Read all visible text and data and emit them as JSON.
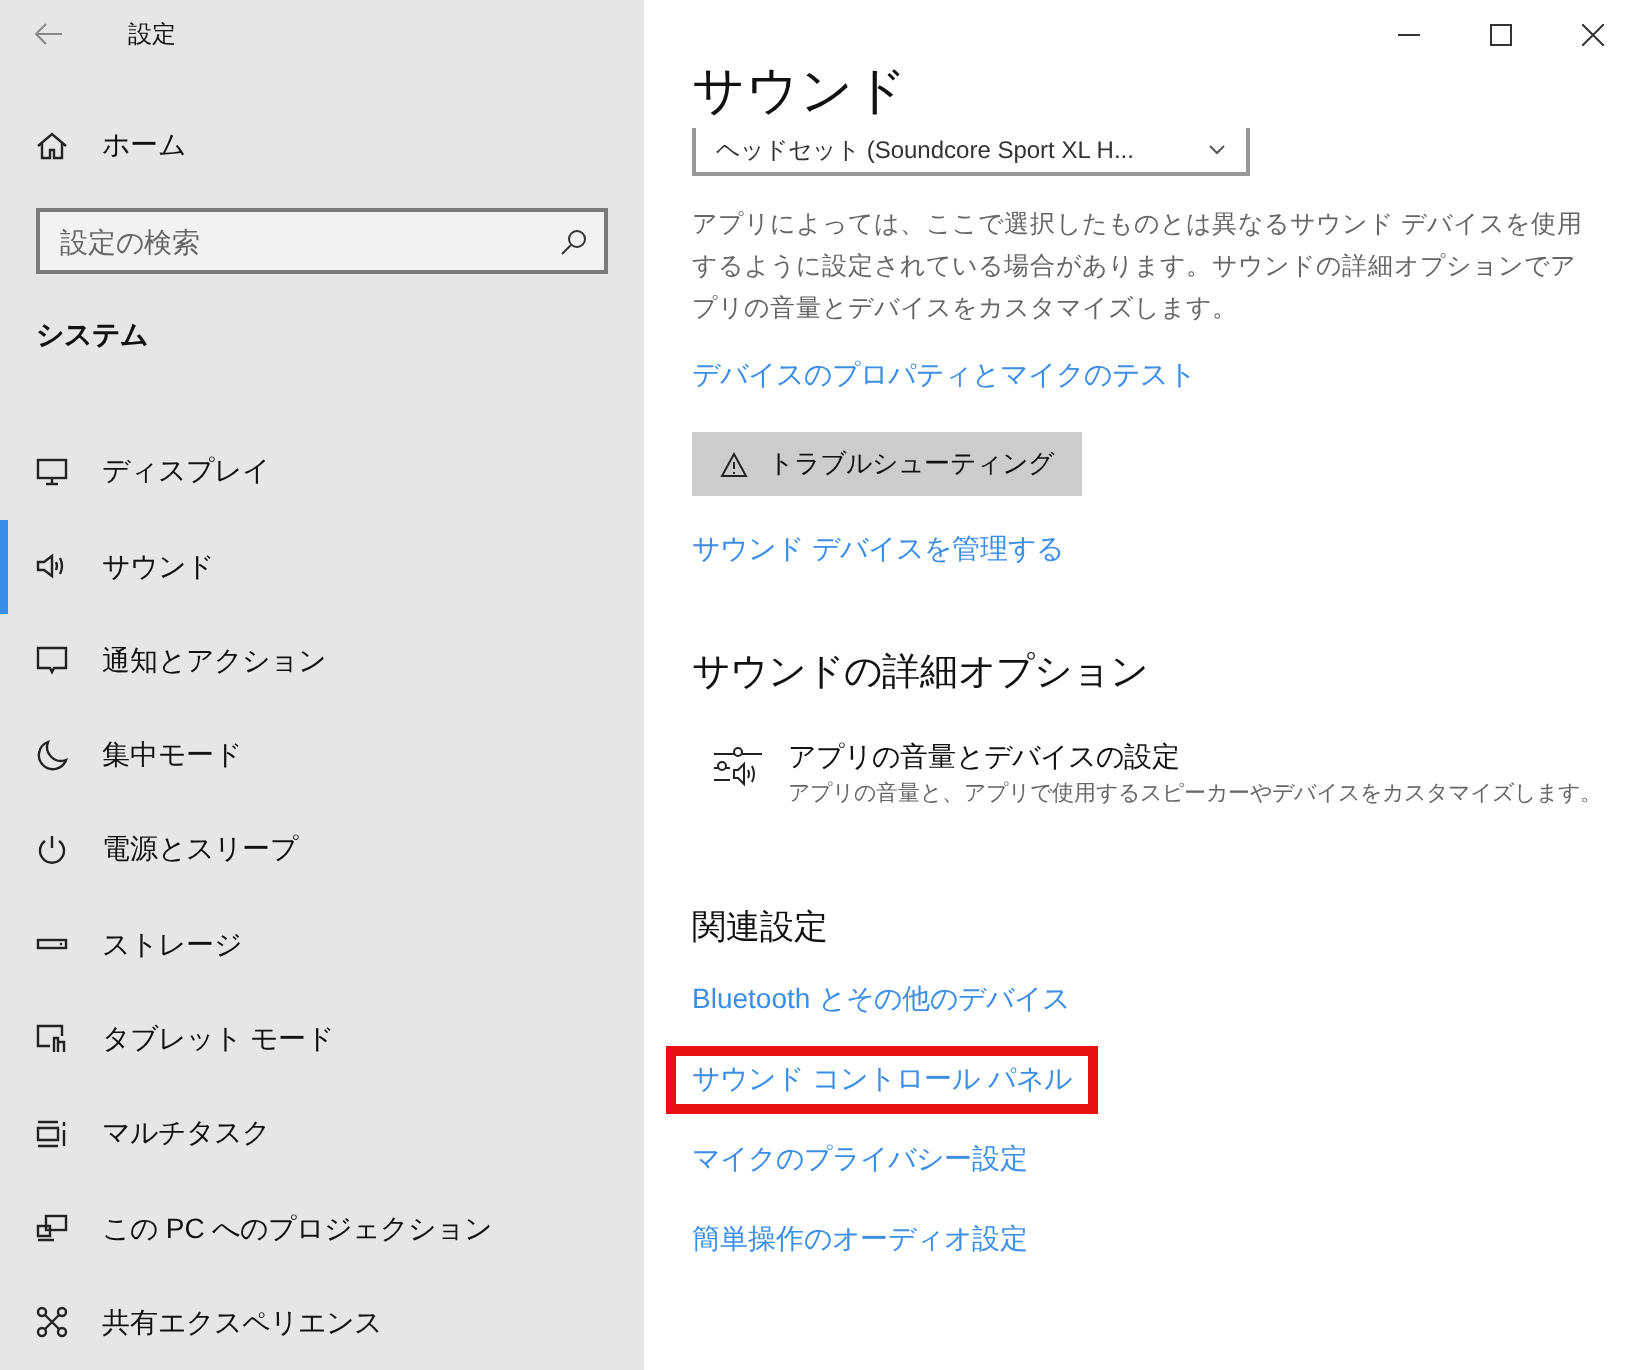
{
  "window": {
    "title": "設定"
  },
  "sidebar": {
    "home": "ホーム",
    "search": {
      "placeholder": "設定の検索"
    },
    "section": "システム",
    "items": [
      {
        "label": "ディスプレイ",
        "selected": false
      },
      {
        "label": "サウンド",
        "selected": true
      },
      {
        "label": "通知とアクション",
        "selected": false
      },
      {
        "label": "集中モード",
        "selected": false
      },
      {
        "label": "電源とスリープ",
        "selected": false
      },
      {
        "label": "ストレージ",
        "selected": false
      },
      {
        "label": "タブレット モード",
        "selected": false
      },
      {
        "label": "マルチタスク",
        "selected": false
      },
      {
        "label": "この PC へのプロジェクション",
        "selected": false
      },
      {
        "label": "共有エクスペリエンス",
        "selected": false
      }
    ]
  },
  "content": {
    "title": "サウンド",
    "device_select": "ヘッドセット (Soundcore Sport XL H...",
    "description": "アプリによっては、ここで選択したものとは異なるサウンド デバイスを使用するように設定されている場合があります。サウンドの詳細オプションでアプリの音量とデバイスをカスタマイズします。",
    "properties_link": "デバイスのプロパティとマイクのテスト",
    "troubleshoot_button": "トラブルシューティング",
    "manage_link": "サウンド デバイスを管理する",
    "advanced": {
      "heading": "サウンドの詳細オプション",
      "title": "アプリの音量とデバイスの設定",
      "subtitle": "アプリの音量と、アプリで使用するスピーカーやデバイスをカスタマイズします。"
    },
    "related": {
      "heading": "関連設定",
      "links": [
        {
          "label": "Bluetooth とその他のデバイス",
          "highlighted": false
        },
        {
          "label": "サウンド コントロール パネル",
          "highlighted": true
        },
        {
          "label": "マイクのプライバシー設定",
          "highlighted": false
        },
        {
          "label": "簡単操作のオーディオ設定",
          "highlighted": false
        }
      ]
    }
  }
}
